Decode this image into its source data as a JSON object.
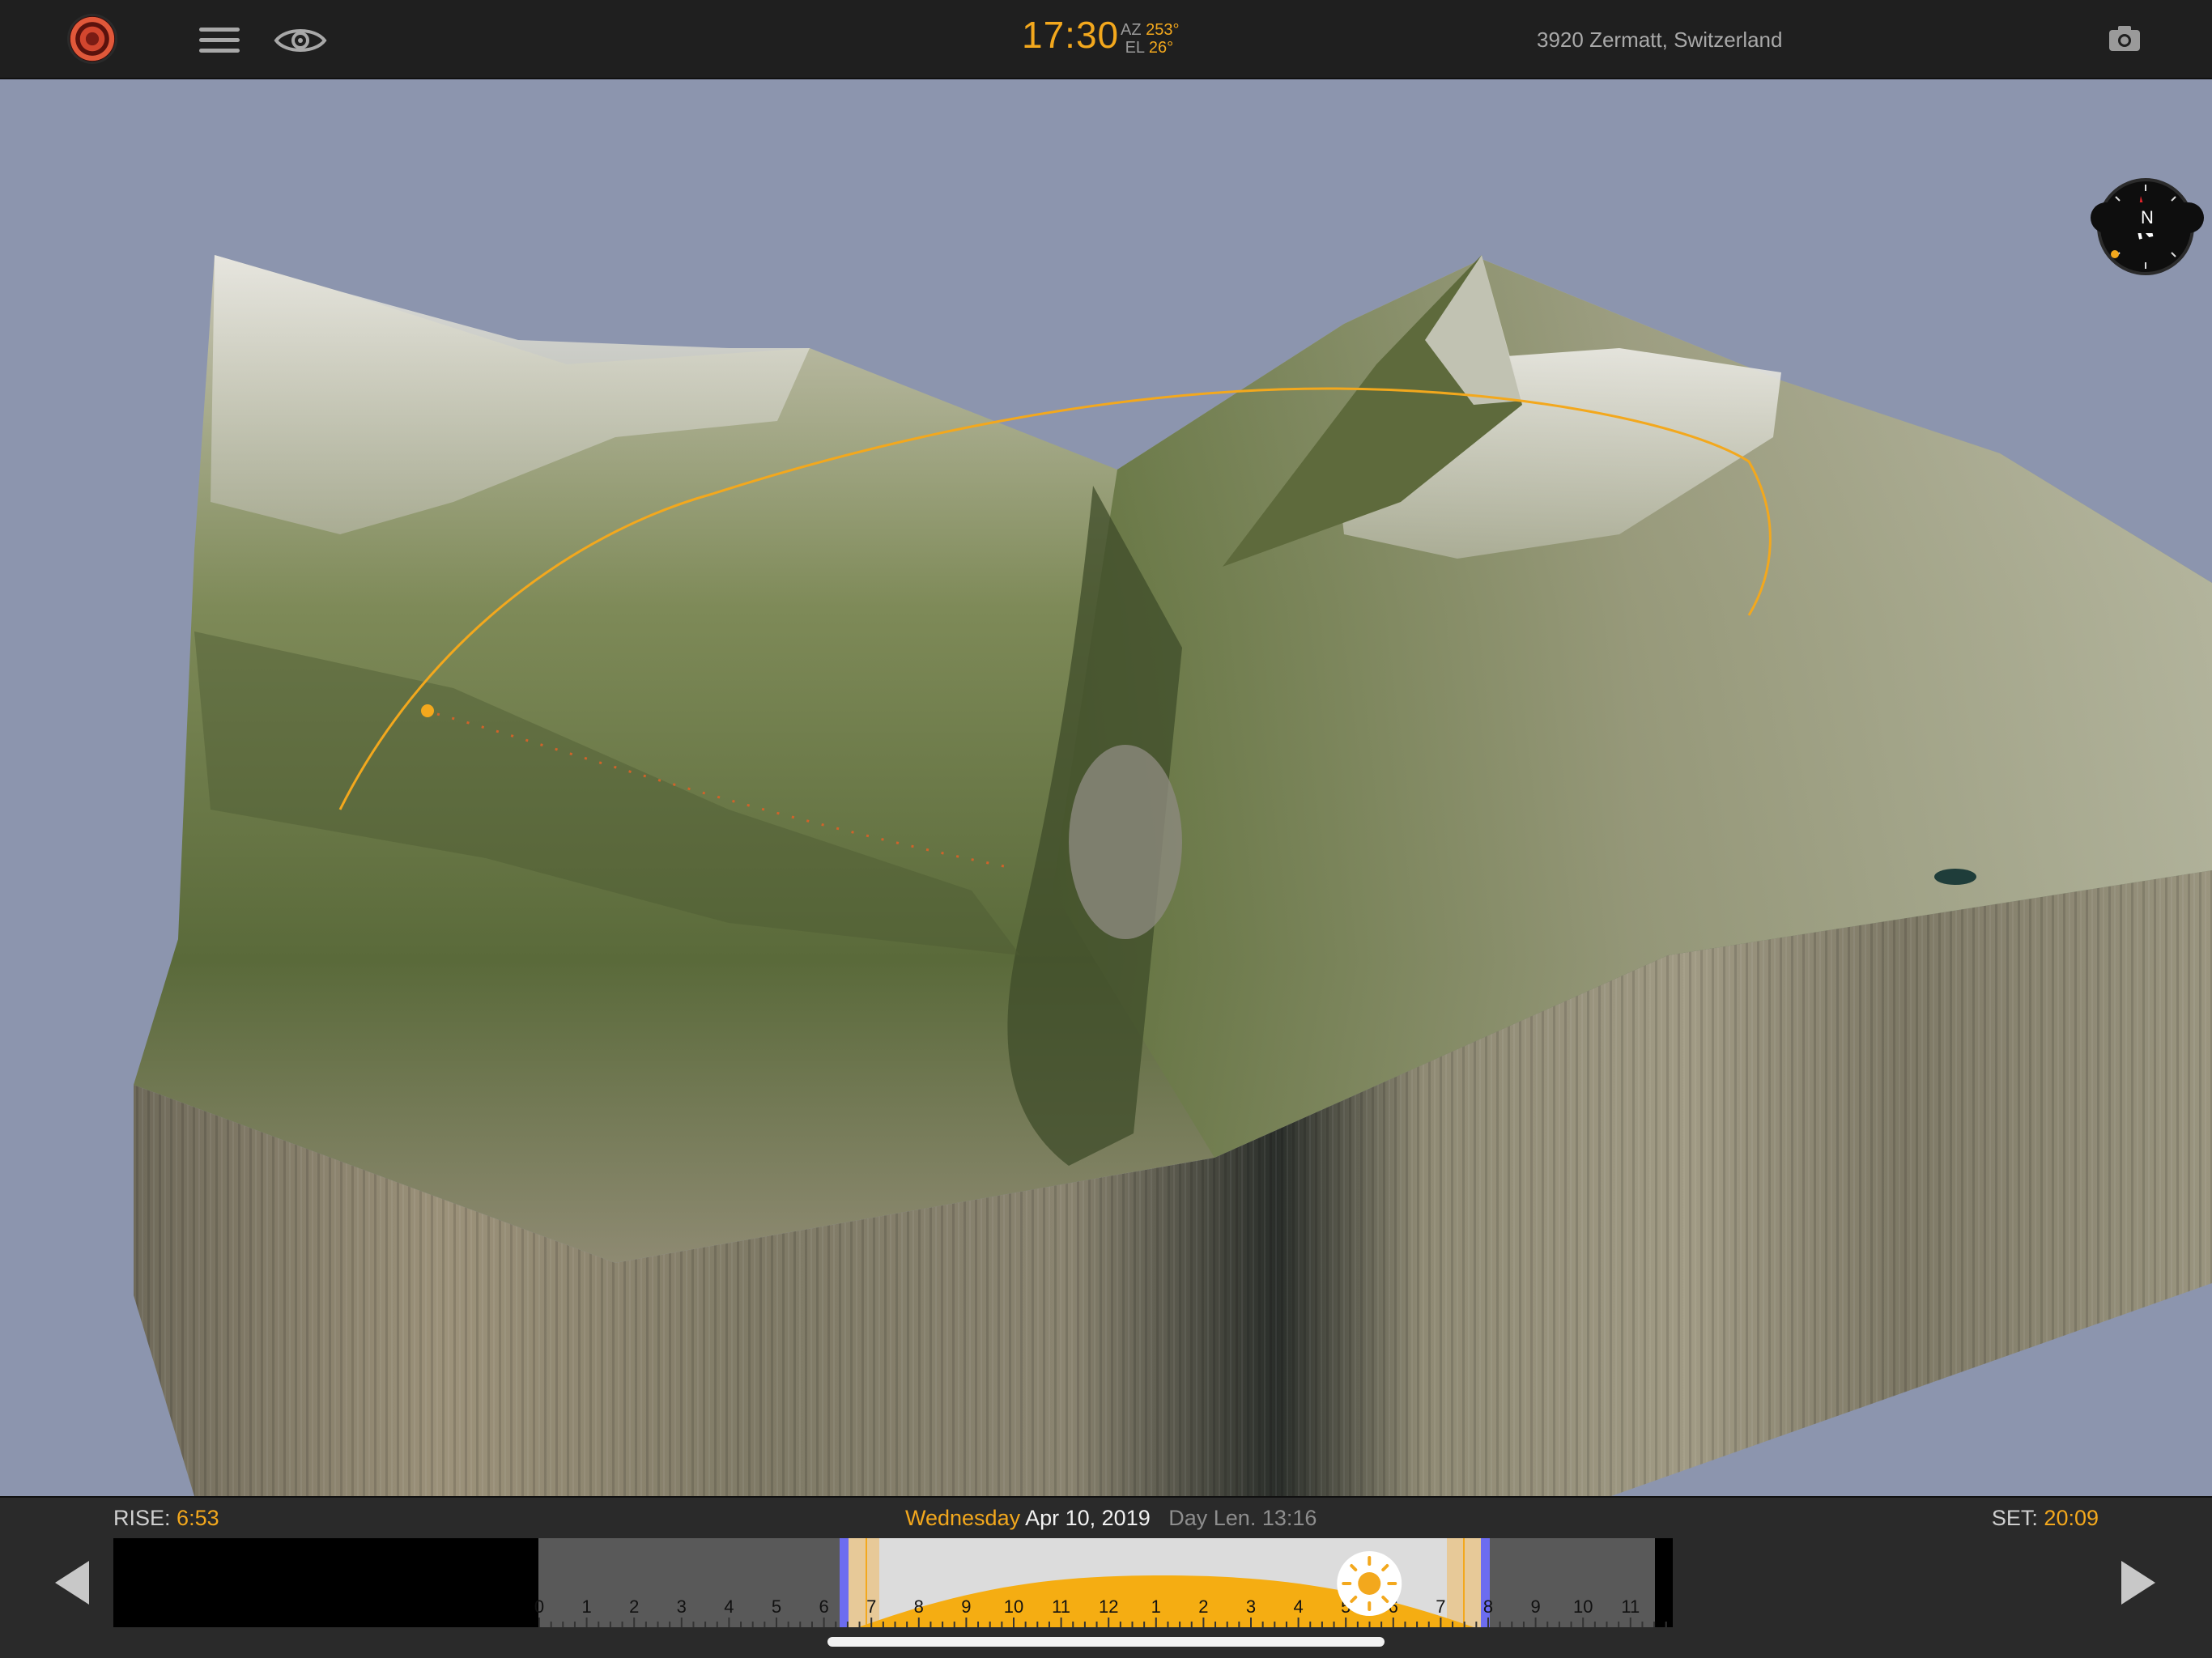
{
  "header": {
    "time": "17:30",
    "az_label": "AZ",
    "az_value": "253°",
    "el_label": "EL",
    "el_value": "26°",
    "location": "3920 Zermatt, Switzerland"
  },
  "compass": {
    "heading_letter": "N",
    "label": "N"
  },
  "footer": {
    "rise_label": "RISE:",
    "rise_value": "6:53",
    "set_label": "SET:",
    "set_value": "20:09",
    "weekday": "Wednesday",
    "date": "Apr 10, 2019",
    "day_length": "Day Len. 13:16"
  },
  "timeline": {
    "hour_labels": [
      "0",
      "1",
      "2",
      "3",
      "4",
      "5",
      "6",
      "7",
      "8",
      "9",
      "10",
      "11",
      "12",
      "1",
      "2",
      "3",
      "4",
      "5",
      "6",
      "7",
      "8",
      "9",
      "10",
      "11"
    ],
    "current_position_fraction": 0.729
  },
  "colors": {
    "accent": "#f3a81d",
    "bar_bg": "#1f1f1f",
    "sky": "#8c95ae",
    "twilight_marker": "#6c6cf0"
  }
}
